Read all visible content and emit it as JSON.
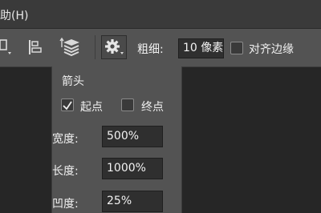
{
  "menubar": {
    "label": "助(H)"
  },
  "toolbar": {
    "icons": [
      "shape-dropdown-icon",
      "align-bottom-icon",
      "arrange-layers-icon",
      "gear-icon"
    ],
    "thickness_label": "粗细:",
    "thickness_value": "10 像素",
    "align_edges_label": "对齐边缘",
    "align_edges_checked": false
  },
  "arrow_panel": {
    "title": "箭头",
    "start_label": "起点",
    "start_checked": true,
    "end_label": "终点",
    "end_checked": false,
    "width_label": "宽度:",
    "width_value": "500%",
    "length_label": "长度:",
    "length_value": "1000%",
    "concavity_label": "凹度:",
    "concavity_value": "25%"
  },
  "colors": {
    "canvas": "#262626",
    "menubar": "#3a3a3a",
    "toolbar": "#535353",
    "field": "#2f2f2f"
  }
}
